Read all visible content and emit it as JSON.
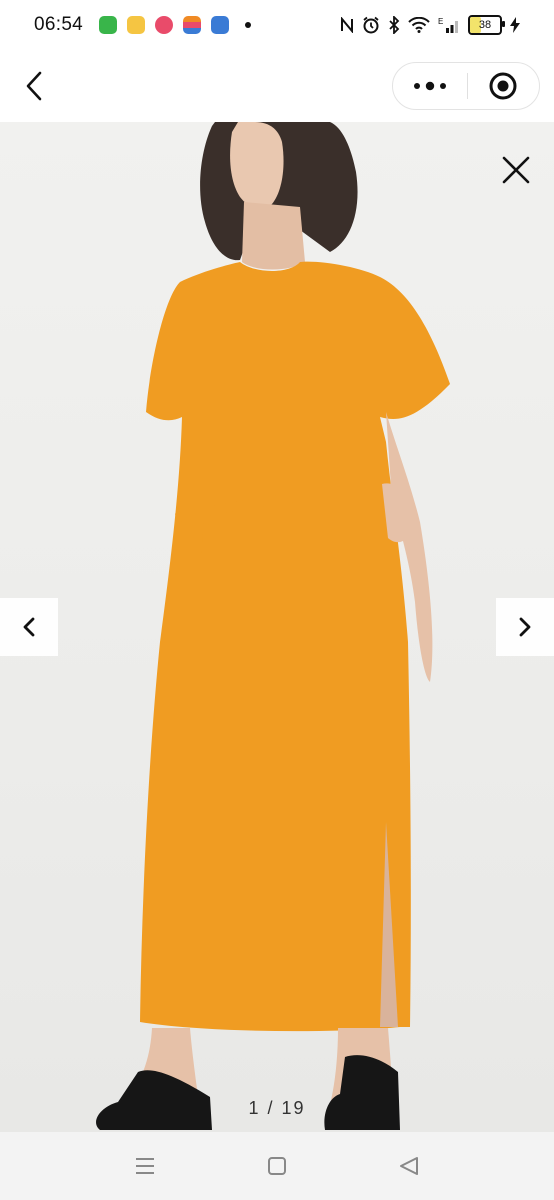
{
  "status_bar": {
    "time": "06:54",
    "battery_level": "38",
    "battery_fraction": 0.38,
    "app_icons": [
      "#39b54a",
      "#f5c542",
      "#e94b6a",
      "#f08a24",
      "#3a7bd5"
    ],
    "right_icons": [
      "nfc-icon",
      "alarm-icon",
      "bluetooth-icon",
      "wifi-icon",
      "signal-icon",
      "battery-icon",
      "charging-icon"
    ]
  },
  "nav": {
    "back_icon": "chevron-left-icon",
    "more_icon": "more-dots-icon",
    "target_icon": "target-icon"
  },
  "viewer": {
    "close_icon": "close-icon",
    "prev_icon": "chevron-left-icon",
    "next_icon": "chevron-right-icon",
    "counter_current": "1",
    "counter_separator": "/",
    "counter_total": "19",
    "dress_color": "#f09c22"
  },
  "system_nav": {
    "menu_icon": "menu-icon",
    "home_icon": "home-square-icon",
    "back_icon": "back-triangle-icon"
  }
}
